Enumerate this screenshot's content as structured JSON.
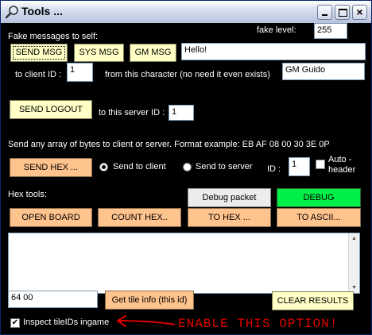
{
  "window": {
    "title": "Tools ...",
    "controls": [
      "minimize",
      "maximize",
      "close"
    ],
    "close_glyph": "×"
  },
  "fake_messages": {
    "section_label": "Fake messages to self:",
    "fake_level_label": "fake level:",
    "fake_level_value": "255",
    "send_msg": "SEND MSG",
    "sys_msg": "SYS MSG",
    "gm_msg": "GM MSG",
    "message_value": "Hello!",
    "to_client_label": "to client ID :",
    "client_id_value": "1",
    "from_char_label": "from this character (no need it even exists)",
    "char_name_value": "GM Guido"
  },
  "logout": {
    "send_logout": "SEND LOGOUT",
    "server_id_label": "to this server ID :",
    "server_id_value": "1"
  },
  "send_hex": {
    "description": "Send any array of bytes to client or server. Format example: EB AF 08 00 30 3E 0P",
    "send_hex_button": "SEND HEX ...",
    "radio_client": "Send to client",
    "radio_server": "Send to server",
    "selected_target": "client",
    "id_label": "ID :",
    "id_value": "1",
    "auto_header_label": "Auto -\nheader",
    "auto_header_checked": false
  },
  "hex_tools": {
    "label": "Hex tools:",
    "debug_packet": "Debug packet",
    "debug": "DEBUG",
    "open_board": "OPEN BOARD",
    "count_hex": "COUNT HEX..",
    "to_hex": "TO HEX ...",
    "to_ascii": "TO ASCII..."
  },
  "results": {
    "content": ""
  },
  "tile": {
    "tile_id_value": "64 00",
    "get_tile_info": "Get tile info (this id)",
    "clear_results": "CLEAR RESULTS"
  },
  "inspect": {
    "label": "Inspect tileIDs ingame",
    "checked": true,
    "check_glyph": "✔"
  },
  "annotation": {
    "text": "ENABLE THIS OPTION!",
    "color": "#e00000"
  },
  "colors": {
    "yellow_button": "#ffffc6",
    "orange_button": "#ffc38e",
    "green_button": "#00f04a",
    "background": "#000000"
  }
}
